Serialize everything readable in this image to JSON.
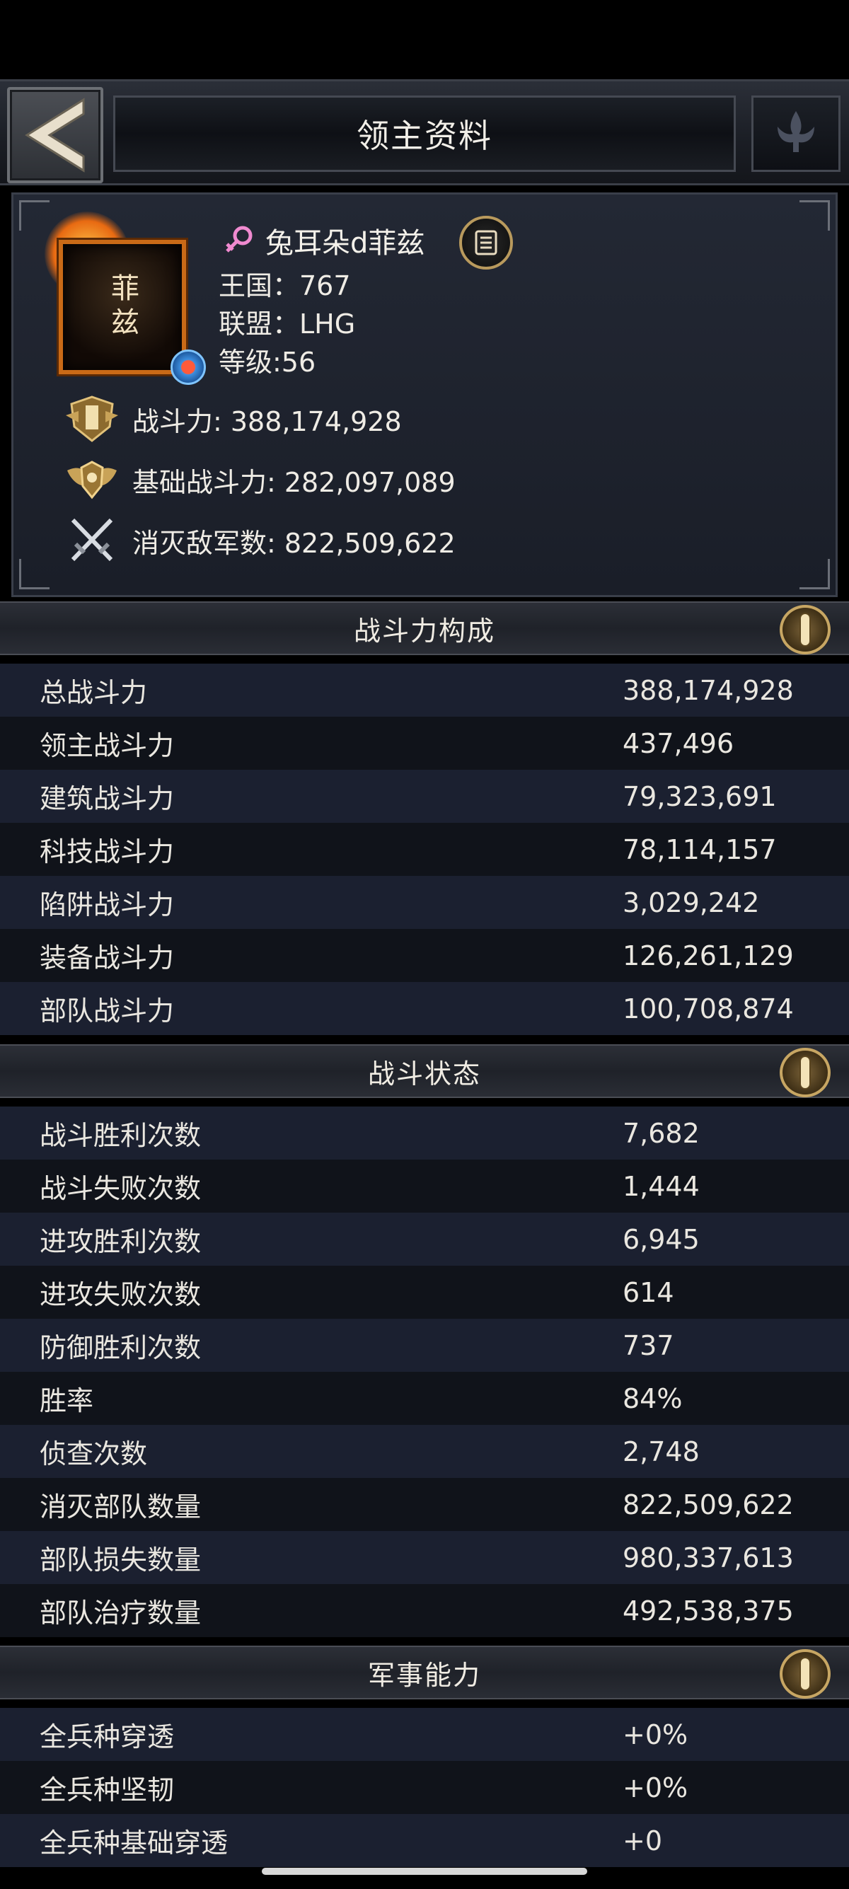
{
  "header": {
    "title": "领主资料"
  },
  "profile": {
    "name": "兔耳朵d菲兹",
    "kingdom": "王国：767",
    "alliance": "联盟：LHG",
    "level": "等级:56",
    "avatar_text": "菲兹",
    "stats": [
      {
        "icon": "power-shield-icon",
        "text": "战斗力: 388,174,928"
      },
      {
        "icon": "winged-shield-icon",
        "text": "基础战斗力: 282,097,089"
      },
      {
        "icon": "crossed-swords-icon",
        "text": "消灭敌军数: 822,509,622"
      }
    ]
  },
  "sections": {
    "power": {
      "title": "战斗力构成",
      "rows": [
        {
          "label": "总战斗力",
          "value": "388,174,928"
        },
        {
          "label": "领主战斗力",
          "value": "437,496"
        },
        {
          "label": "建筑战斗力",
          "value": "79,323,691"
        },
        {
          "label": "科技战斗力",
          "value": "78,114,157"
        },
        {
          "label": "陷阱战斗力",
          "value": "3,029,242"
        },
        {
          "label": "装备战斗力",
          "value": "126,261,129"
        },
        {
          "label": "部队战斗力",
          "value": "100,708,874"
        }
      ]
    },
    "battle": {
      "title": "战斗状态",
      "rows": [
        {
          "label": "战斗胜利次数",
          "value": "7,682"
        },
        {
          "label": "战斗失败次数",
          "value": "1,444"
        },
        {
          "label": "进攻胜利次数",
          "value": "6,945"
        },
        {
          "label": "进攻失败次数",
          "value": "614"
        },
        {
          "label": "防御胜利次数",
          "value": "737"
        },
        {
          "label": "胜率",
          "value": "84%"
        },
        {
          "label": "侦查次数",
          "value": "2,748"
        },
        {
          "label": "消灭部队数量",
          "value": "822,509,622"
        },
        {
          "label": "部队损失数量",
          "value": "980,337,613"
        },
        {
          "label": "部队治疗数量",
          "value": "492,538,375"
        }
      ]
    },
    "military": {
      "title": "军事能力",
      "rows": [
        {
          "label": "全兵种穿透",
          "value": "+0%"
        },
        {
          "label": "全兵种坚韧",
          "value": "+0%"
        },
        {
          "label": "全兵种基础穿透",
          "value": "+0"
        }
      ]
    }
  },
  "colors": {
    "accent_gold": "#c7a663",
    "panel": "#1b2030",
    "background": "#10131a"
  }
}
